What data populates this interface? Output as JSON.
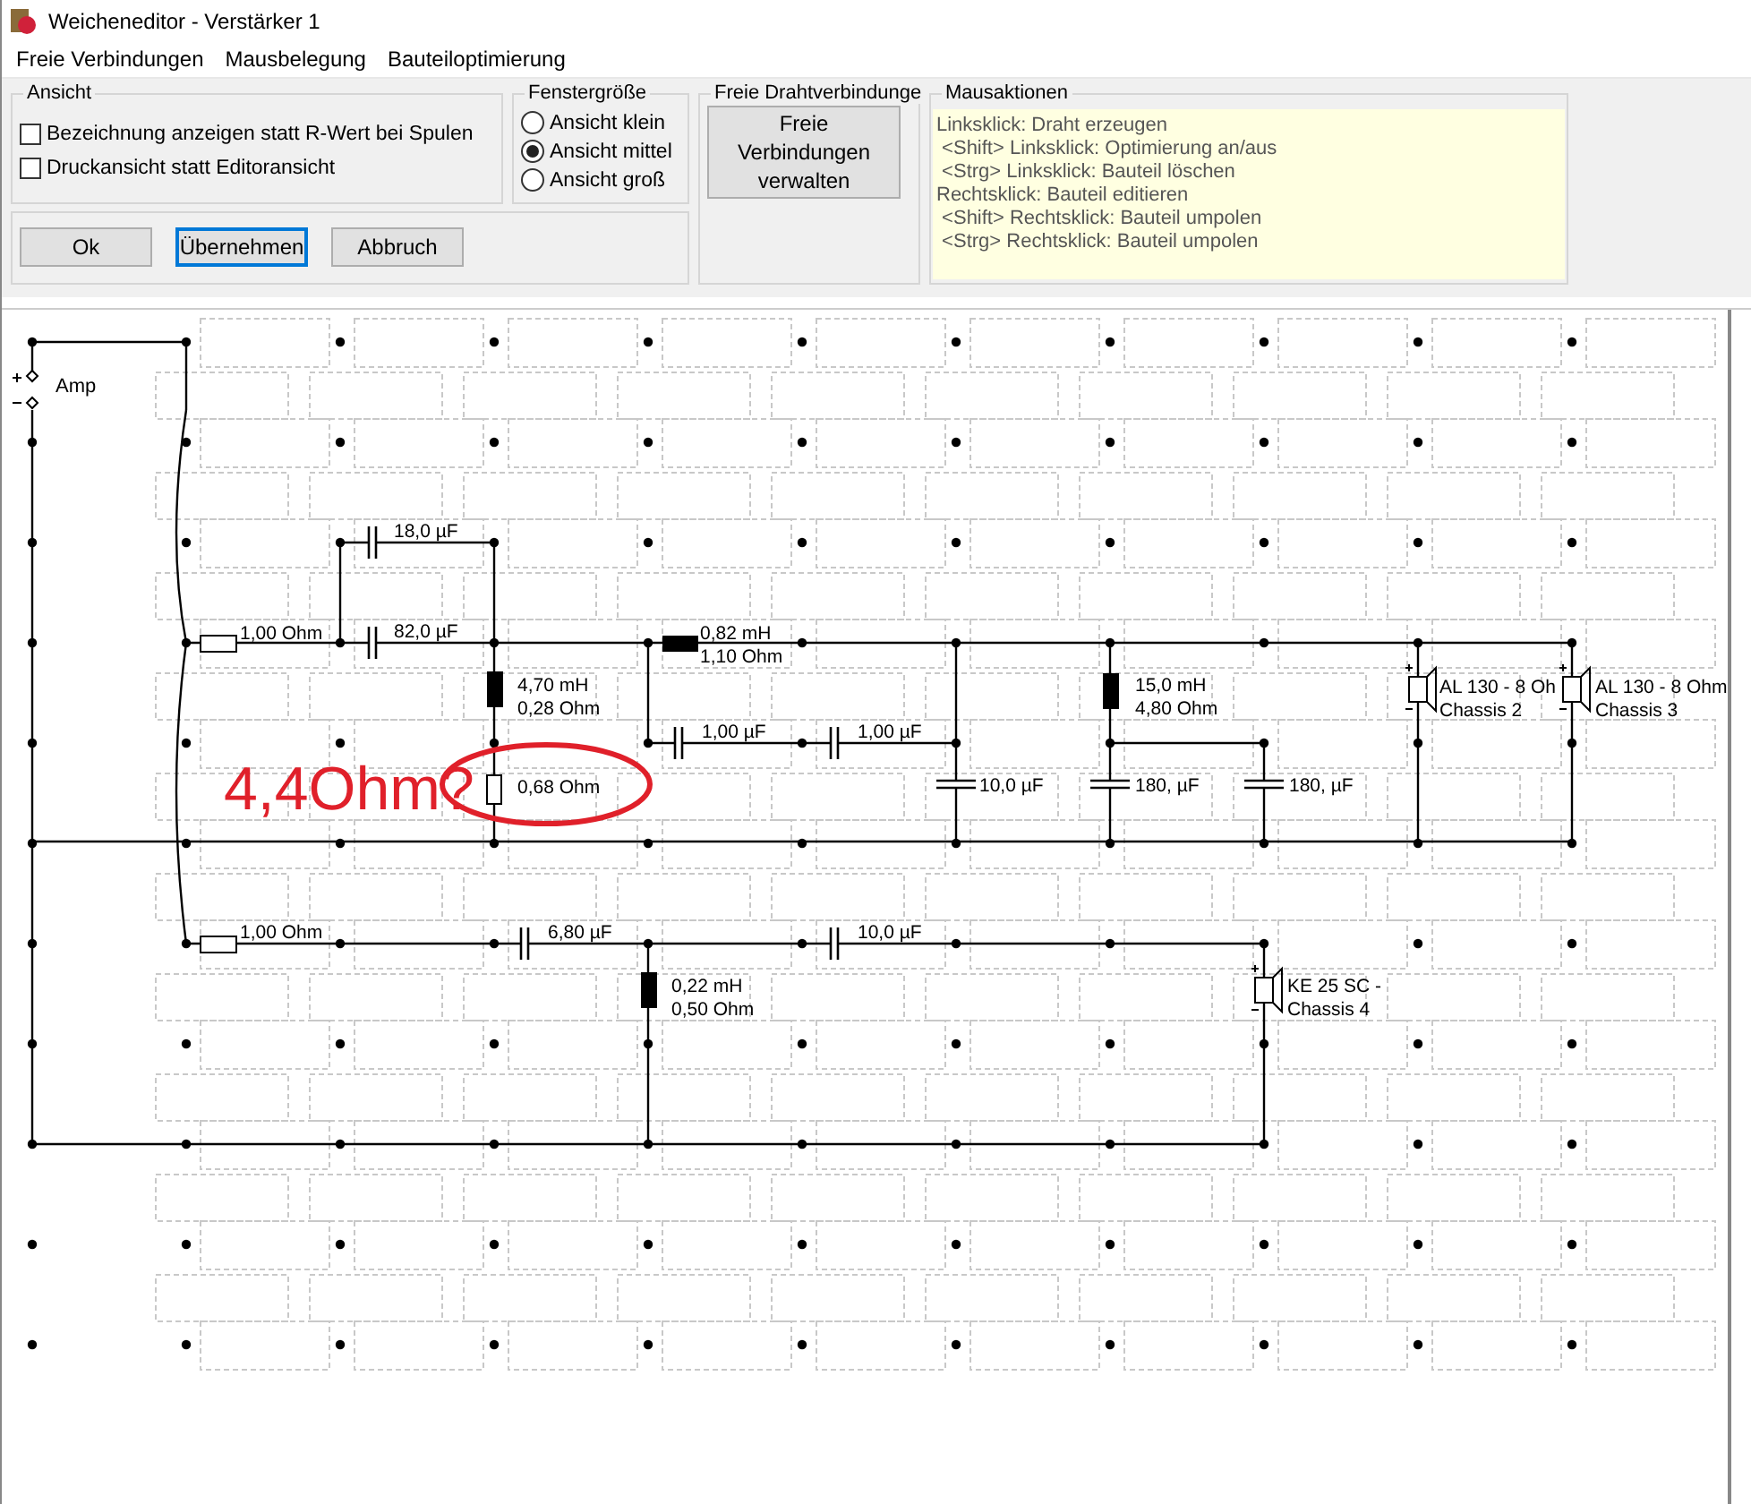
{
  "window": {
    "title": "Weicheneditor - Verstärker 1"
  },
  "menu": [
    "Freie Verbindungen",
    "Mausbelegung",
    "Bauteiloptimierung"
  ],
  "view_group": {
    "title": "Ansicht",
    "options": [
      {
        "label": "Bezeichnung anzeigen statt R-Wert bei Spulen",
        "checked": false
      },
      {
        "label": "Druckansicht statt Editoransicht",
        "checked": false
      }
    ]
  },
  "size_group": {
    "title": "Fenstergröße",
    "options": [
      {
        "label": "Ansicht klein",
        "selected": false
      },
      {
        "label": "Ansicht mittel",
        "selected": true
      },
      {
        "label": "Ansicht groß",
        "selected": false
      }
    ]
  },
  "buttons": [
    {
      "label": "Ok",
      "focused": false
    },
    {
      "label": "Übernehmen",
      "focused": true
    },
    {
      "label": "Abbruch",
      "focused": false
    }
  ],
  "wire_group": {
    "title": "Freie Drahtverbindunge",
    "button": "Freie Verbindungen verwalten"
  },
  "mouse_group": {
    "title": "Mausaktionen",
    "lines": [
      "Linksklick: Draht erzeugen",
      " <Shift> Linksklick: Optimierung an/aus",
      " <Strg> Linksklick: Bauteil löschen",
      "Rechtsklick: Bauteil editieren",
      " <Shift> Rechtsklick: Bauteil umpolen",
      " <Strg> Rechtsklick: Bauteil umpolen"
    ]
  },
  "circuit": {
    "source_label": "Amp",
    "components": [
      {
        "kind": "resistor",
        "lines": [
          "1,00 Ohm"
        ]
      },
      {
        "kind": "capacitor",
        "lines": [
          "18,0 µF"
        ]
      },
      {
        "kind": "capacitor",
        "lines": [
          "82,0 µF"
        ]
      },
      {
        "kind": "inductor",
        "lines": [
          "0,82 mH",
          "1,10 Ohm"
        ]
      },
      {
        "kind": "inductor",
        "lines": [
          "4,70 mH",
          "0,28 Ohm"
        ]
      },
      {
        "kind": "resistor",
        "lines": [
          "0,68 Ohm"
        ]
      },
      {
        "kind": "capacitor",
        "lines": [
          "1,00 µF"
        ]
      },
      {
        "kind": "capacitor",
        "lines": [
          "1,00 µF"
        ]
      },
      {
        "kind": "capacitor",
        "lines": [
          "10,0 µF"
        ]
      },
      {
        "kind": "inductor",
        "lines": [
          "15,0 mH",
          "4,80 Ohm"
        ]
      },
      {
        "kind": "capacitor",
        "lines": [
          "180, µF"
        ]
      },
      {
        "kind": "capacitor",
        "lines": [
          "180, µF"
        ]
      },
      {
        "kind": "speaker",
        "lines": [
          "AL 130 - 8 Oh",
          "Chassis 2"
        ]
      },
      {
        "kind": "speaker",
        "lines": [
          "AL 130 - 8 Ohm",
          "Chassis 3"
        ]
      },
      {
        "kind": "resistor",
        "lines": [
          "1,00 Ohm"
        ]
      },
      {
        "kind": "capacitor",
        "lines": [
          "6,80 µF"
        ]
      },
      {
        "kind": "capacitor",
        "lines": [
          "10,0 µF"
        ]
      },
      {
        "kind": "inductor",
        "lines": [
          "0,22 mH",
          "0,50 Ohm"
        ]
      },
      {
        "kind": "speaker",
        "lines": [
          "KE 25 SC -",
          "Chassis 4"
        ]
      }
    ],
    "annotation": {
      "text": "4,4Ohm?"
    }
  }
}
